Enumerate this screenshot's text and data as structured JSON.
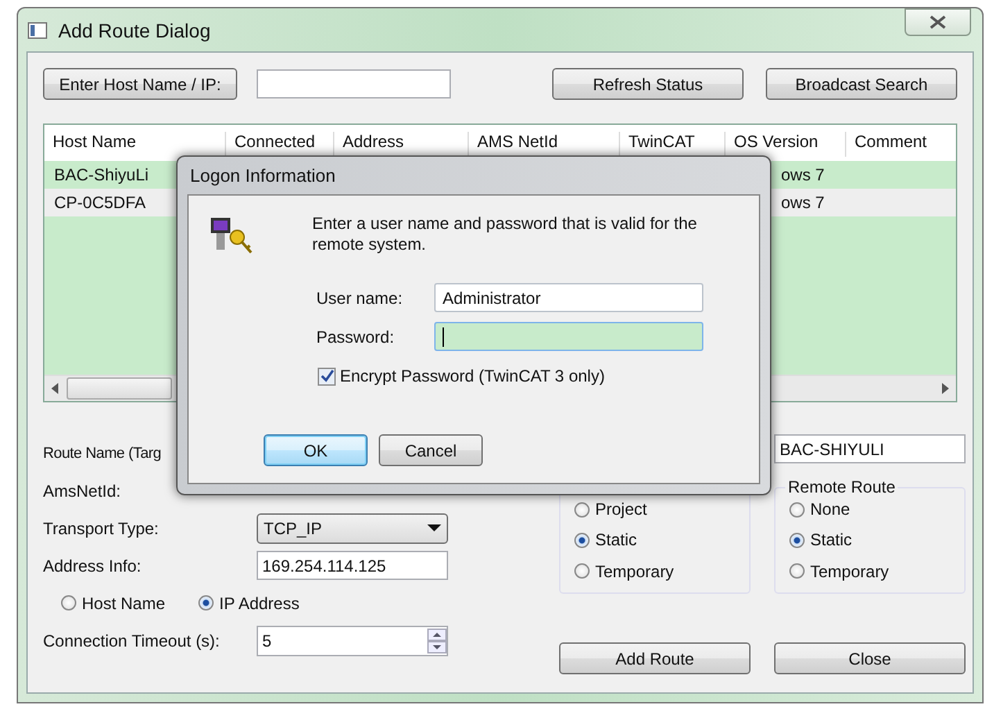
{
  "window": {
    "title": "Add Route Dialog"
  },
  "toolbar": {
    "host_button": "Enter Host Name / IP:",
    "refresh_button": "Refresh Status",
    "broadcast_button": "Broadcast Search"
  },
  "table": {
    "columns": [
      "Host Name",
      "Connected",
      "Address",
      "AMS NetId",
      "TwinCAT",
      "OS Version",
      "Comment"
    ],
    "rows": [
      {
        "host_name": "BAC-ShiyuLi",
        "os_version": "ows 7",
        "selected": true
      },
      {
        "host_name": "CP-0C5DFA",
        "os_version": "ows 7",
        "selected": false
      }
    ]
  },
  "form": {
    "route_name_label": "Route Name (Targ",
    "ams_net_id_label": "AmsNetId:",
    "transport": {
      "label": "Transport Type:",
      "value": "TCP_IP"
    },
    "address": {
      "label": "Address Info:",
      "value": "169.254.114.125"
    },
    "address_mode": [
      {
        "label": "Host Name",
        "selected": false
      },
      {
        "label": "IP Address",
        "selected": true
      }
    ],
    "timeout": {
      "label": "Connection Timeout (s):",
      "value": "5"
    },
    "target_name": {
      "value": "BAC-SHIYULI"
    },
    "target_route": {
      "options": [
        {
          "label": "Project",
          "selected": false
        },
        {
          "label": "Static",
          "selected": true
        },
        {
          "label": "Temporary",
          "selected": false
        }
      ]
    },
    "remote_route": {
      "title": "Remote Route",
      "options": [
        {
          "label": "None",
          "selected": false
        },
        {
          "label": "Static",
          "selected": true
        },
        {
          "label": "Temporary",
          "selected": false
        }
      ]
    },
    "buttons": [
      "Add Route",
      "Close"
    ]
  },
  "dialog": {
    "title": "Logon Information",
    "message": "Enter a user name and password that is valid for the remote system.",
    "fields": [
      {
        "label": "User name:",
        "value": "Administrator",
        "focused": false
      },
      {
        "label": "Password:",
        "focused": true
      }
    ],
    "checkbox": {
      "label": "Encrypt Password (TwinCAT 3 only)",
      "checked": true
    },
    "buttons": [
      {
        "label": "OK",
        "default": true
      },
      {
        "label": "Cancel",
        "default": false
      }
    ]
  }
}
